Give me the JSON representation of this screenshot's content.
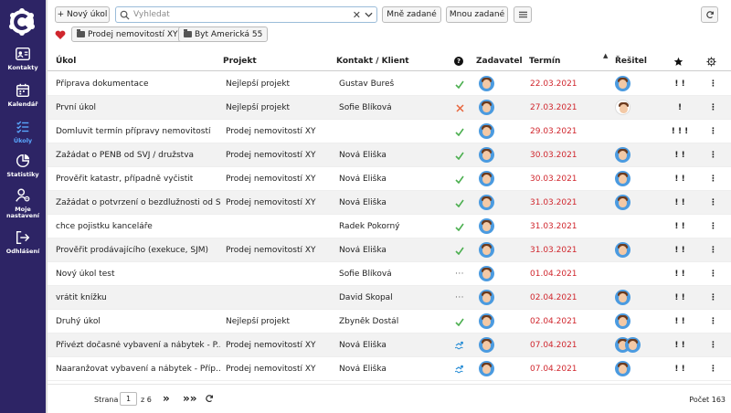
{
  "sidebar": {
    "items": [
      {
        "label": "Kontakty",
        "icon": "contacts-icon"
      },
      {
        "label": "Kalendář",
        "icon": "calendar-icon"
      },
      {
        "label": "Úkoly",
        "icon": "tasks-icon",
        "active": true
      },
      {
        "label": "Statistiky",
        "icon": "pie-chart-icon"
      },
      {
        "label": "Moje nastavení",
        "icon": "user-settings-icon"
      },
      {
        "label": "Odhlášení",
        "icon": "logout-icon"
      }
    ]
  },
  "toolbar": {
    "new_task": "+ Nový úkol",
    "search_placeholder": "Vyhledat",
    "assigned_to_me": "Mně zadané",
    "assigned_by_me": "Mnou zadané"
  },
  "filters": {
    "chips": [
      "Prodej nemovitostí XY",
      "Byt Americká 55"
    ]
  },
  "table": {
    "headers": {
      "task": "Úkol",
      "project": "Projekt",
      "contact": "Kontakt / Klient",
      "assigner": "Zadavatel",
      "deadline": "Termín",
      "solver": "Řešitel"
    },
    "rows": [
      {
        "task": "Příprava dokumentace",
        "project": "Nejlepší projekt",
        "contact": "Gustav Bureš",
        "status": "done",
        "deadline": "22.03.2021",
        "solver": "avatar",
        "priority": "! !"
      },
      {
        "task": "První úkol",
        "project": "Nejlepší projekt",
        "contact": "Sofie Blíková",
        "status": "cancel",
        "deadline": "27.03.2021",
        "solver": "avatar-white",
        "priority": "!"
      },
      {
        "task": "Domluvit termín přípravy nemovitostí",
        "project": "Prodej nemovitostí XY",
        "contact": "",
        "status": "done",
        "deadline": "29.03.2021",
        "solver": "",
        "priority": "! ! !"
      },
      {
        "task": "Zažádat o PENB od SVJ / družstva",
        "project": "Prodej nemovitostí XY",
        "contact": "Nová Eliška",
        "status": "done",
        "deadline": "30.03.2021",
        "solver": "avatar",
        "priority": "! !"
      },
      {
        "task": "Prověřit katastr, případně vyčistit",
        "project": "Prodej nemovitostí XY",
        "contact": "Nová Eliška",
        "status": "done",
        "deadline": "30.03.2021",
        "solver": "avatar",
        "priority": "! !"
      },
      {
        "task": "Zažádat o potvrzení o bezdlužnosti od S...",
        "project": "Prodej nemovitostí XY",
        "contact": "Nová Eliška",
        "status": "done",
        "deadline": "31.03.2021",
        "solver": "avatar",
        "priority": "! !"
      },
      {
        "task": "chce pojistku kanceláře",
        "project": "",
        "contact": "Radek Pokorný",
        "status": "done",
        "deadline": "31.03.2021",
        "solver": "",
        "priority": "! !"
      },
      {
        "task": "Prověřit prodávajícího (exekuce, SJM)",
        "project": "Prodej nemovitostí XY",
        "contact": "Nová Eliška",
        "status": "done",
        "deadline": "31.03.2021",
        "solver": "avatar",
        "priority": "! !"
      },
      {
        "task": "Nový úkol test",
        "project": "",
        "contact": "Sofie Blíková",
        "status": "pending",
        "deadline": "01.04.2021",
        "solver": "",
        "priority": "! !"
      },
      {
        "task": "vrátit knížku",
        "project": "",
        "contact": "David Skopal",
        "status": "pending",
        "deadline": "02.04.2021",
        "solver": "avatar",
        "priority": "! !"
      },
      {
        "task": "Druhý úkol",
        "project": "Nejlepší projekt",
        "contact": "Zbyněk Dostál",
        "status": "done",
        "deadline": "02.04.2021",
        "solver": "avatar",
        "priority": "! !"
      },
      {
        "task": "Přivézt dočasné vybavení a nábytek - P...",
        "project": "Prodej nemovitostí XY",
        "contact": "Nová Eliška",
        "status": "in-progress",
        "deadline": "07.04.2021",
        "solver": "avatar-pair",
        "priority": "! !"
      },
      {
        "task": "Naaranžovat vybavení a nábytek - Příp...",
        "project": "Prodej nemovitostí XY",
        "contact": "Nová Eliška",
        "status": "in-progress",
        "deadline": "07.04.2021",
        "solver": "avatar",
        "priority": "! !"
      }
    ]
  },
  "footer": {
    "page_label": "Strana",
    "page_value": "1",
    "page_of": "z 6",
    "total": "Počet 163"
  },
  "colors": {
    "sidebar": "#2d2465",
    "deadline": "#d0262d",
    "done": "#4caf50",
    "cancel": "#e8663d",
    "active_nav": "#5aa9ff"
  }
}
